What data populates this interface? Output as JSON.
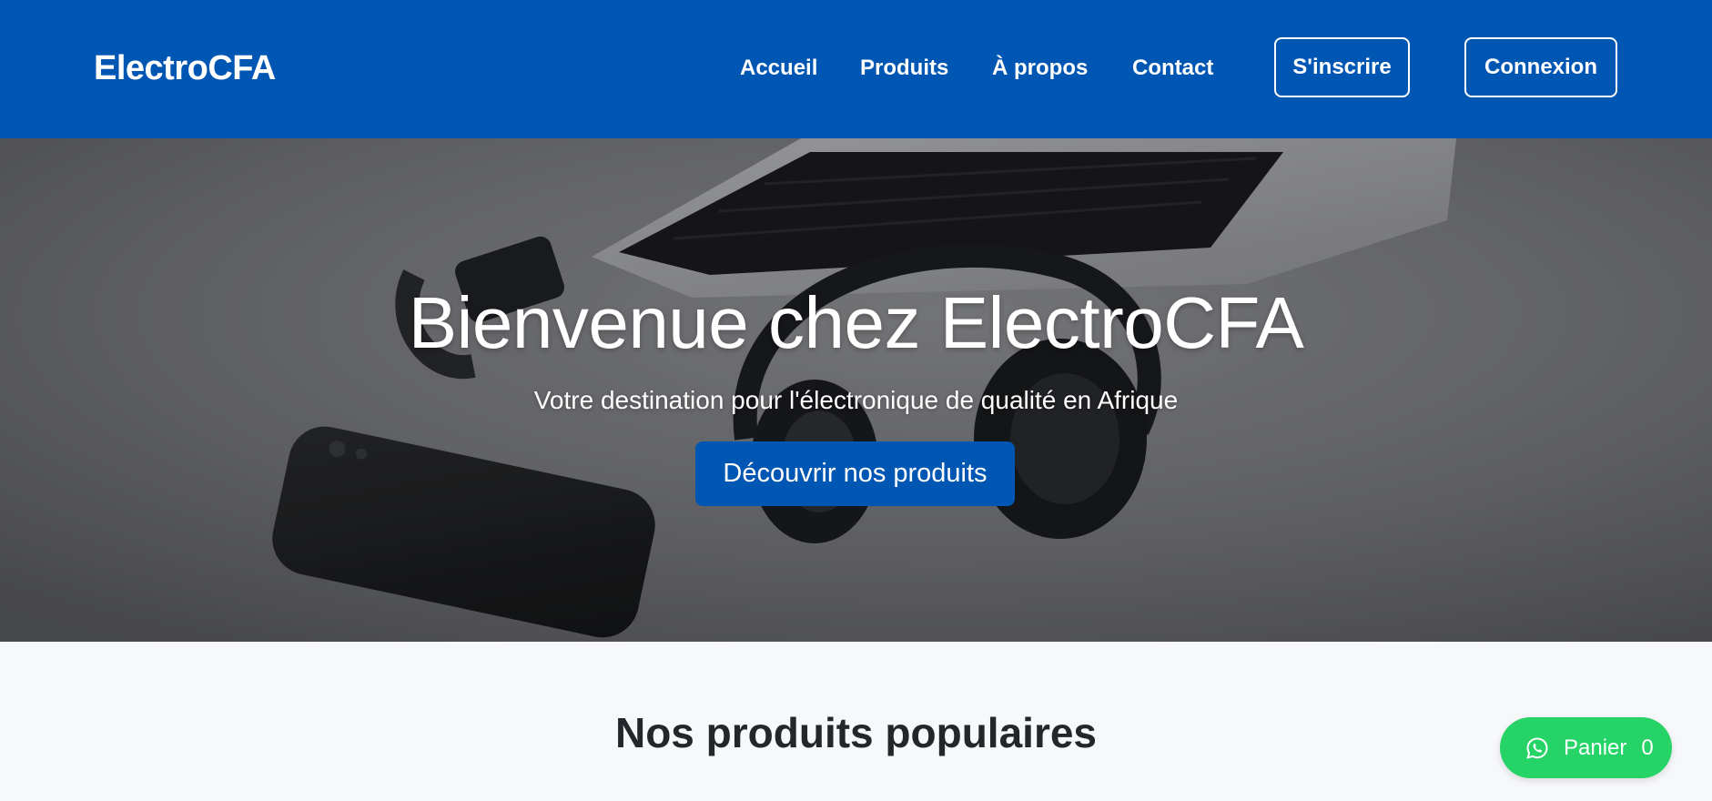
{
  "navbar": {
    "brand": "ElectroCFA",
    "links": [
      {
        "label": "Accueil"
      },
      {
        "label": "Produits"
      },
      {
        "label": "À propos"
      },
      {
        "label": "Contact"
      }
    ],
    "signup_label": "S'inscrire",
    "login_label": "Connexion",
    "background_color": "#0056b3"
  },
  "hero": {
    "title": "Bienvenue chez ElectroCFA",
    "subtitle": "Votre destination pour l'électronique de qualité en Afrique",
    "cta_label": "Découvrir nos produits",
    "background_image": "grayscale desk photo with smartphone, smartwatch, headphones and laptop"
  },
  "section": {
    "title": "Nos produits populaires"
  },
  "cart": {
    "icon": "whatsapp-icon",
    "label": "Panier",
    "count": "0",
    "color": "#25d366"
  }
}
